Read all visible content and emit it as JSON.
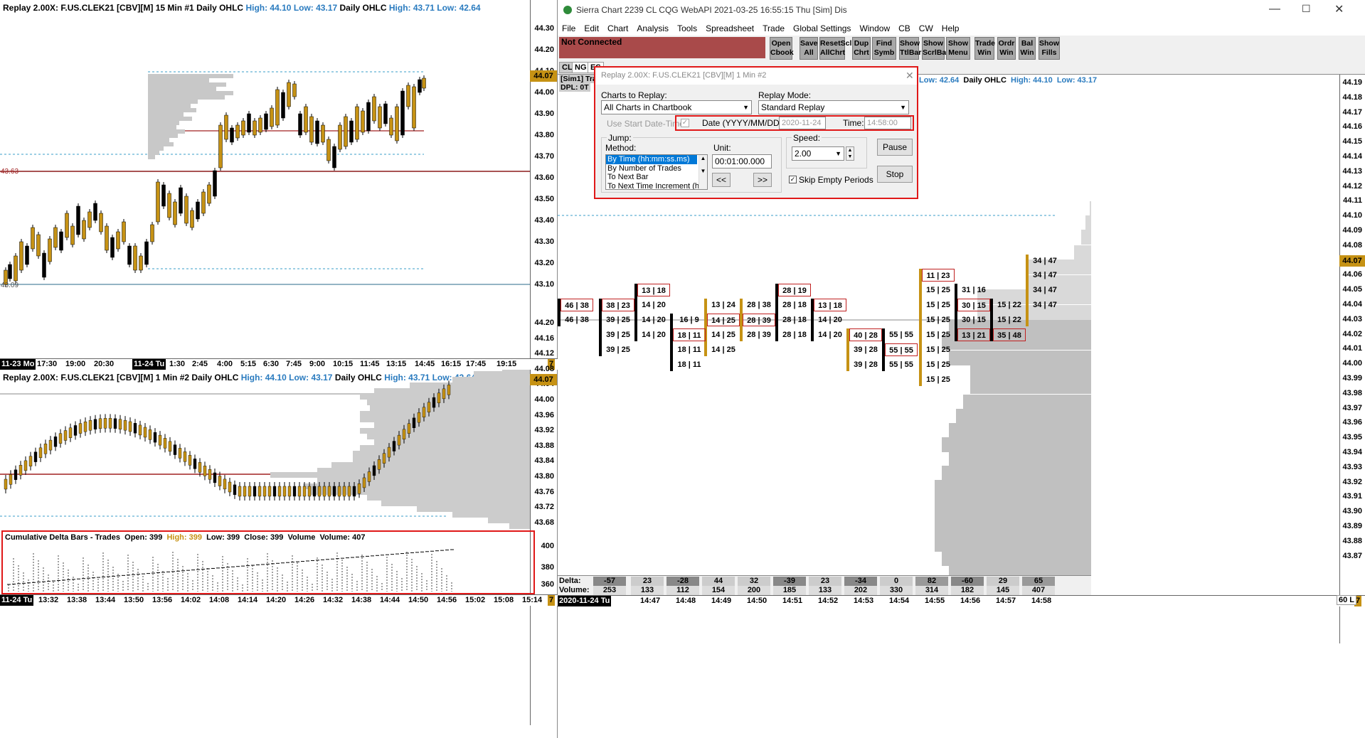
{
  "chart1": {
    "header_prefix": "Replay 2.00X: F.US.CLEK21 [CBV][M]  15 Min  #1 Daily OHLC",
    "high_text": "High: 44.10",
    "low_text": "Low: 43.17",
    "daily_label": "Daily OHLC",
    "daily_high": "High: 43.71",
    "daily_low": "Low: 42.64",
    "yticks": [
      "44.30",
      "44.20",
      "44.10",
      "44.00",
      "43.90",
      "43.80",
      "43.70",
      "43.60",
      "43.50",
      "43.40",
      "43.30",
      "43.20",
      "43.10"
    ],
    "current_price": "44.07",
    "line_label": "43.63",
    "corner_label": "43.09",
    "xticks": [
      "17:30",
      "19:00",
      "20:30",
      "1:30",
      "2:45",
      "4:00",
      "5:15",
      "6:30",
      "7:45",
      "9:00",
      "10:15",
      "11:45",
      "13:15",
      "14:45",
      "16:15",
      "17:45",
      "19:15"
    ],
    "date_start": "11-23 Mo",
    "date_mid": "11-24 Tu",
    "page_num": "7"
  },
  "chart2": {
    "header_prefix": "Replay 2.00X: F.US.CLEK21 [CBV][M]  1 Min  #2 Daily OHLC",
    "high_text": "High: 44.10",
    "low_text": "Low: 43.17",
    "daily_label": "Daily OHLC",
    "daily_high": "High: 43.71",
    "daily_low": "Low: 42.64",
    "yticks": [
      "44.20",
      "44.16",
      "44.12",
      "44.08",
      "44.04",
      "44.00",
      "43.96",
      "43.92",
      "43.88",
      "43.84",
      "43.80",
      "43.76",
      "43.72",
      "43.68"
    ],
    "current_price": "44.07",
    "study_header": "Cumulative Delta Bars - Trades",
    "study_open": "Open: 399",
    "study_high": "High: 399",
    "study_low": "Low: 399",
    "study_close": "Close: 399",
    "study_volume": "Volume",
    "study_volume2": "Volume: 407",
    "study_yticks": [
      "400",
      "380",
      "360"
    ],
    "xticks": [
      "13:32",
      "13:38",
      "13:44",
      "13:50",
      "13:56",
      "14:02",
      "14:08",
      "14:14",
      "14:20",
      "14:26",
      "14:32",
      "14:38",
      "14:44",
      "14:50",
      "14:56",
      "15:02",
      "15:08",
      "15:14"
    ],
    "date_start": "11-24 Tu",
    "page_num": "7"
  },
  "app": {
    "title": "Sierra Chart 2239 CL  CQG WebAPI 2021-03-25  16:55:15 Thu [Sim]  Dis",
    "menu": [
      "File",
      "Edit",
      "Chart",
      "Analysis",
      "Tools",
      "Spreadsheet",
      "Trade",
      "Global Settings",
      "Window",
      "CB",
      "CW",
      "Help"
    ],
    "status": "Not Connected",
    "toolbar": [
      {
        "l1": "Open",
        "l2": "Cbook"
      },
      {
        "l1": "Save",
        "l2": "All"
      },
      {
        "l1": "ResetScl",
        "l2": "AllChrt"
      },
      {
        "l1": "Dup",
        "l2": "Chrt"
      },
      {
        "l1": "Find",
        "l2": "Symb"
      },
      {
        "l1": "Show",
        "l2": "TtlBar"
      },
      {
        "l1": "Show",
        "l2": "ScrlBar"
      },
      {
        "l1": "Show",
        "l2": "Menu"
      },
      {
        "l1": "Trade",
        "l2": "Win"
      },
      {
        "l1": "Ordr",
        "l2": "Win"
      },
      {
        "l1": "Bal",
        "l2": "Win"
      },
      {
        "l1": "Show",
        "l2": "Fills"
      }
    ],
    "tabs": [
      "CL",
      "NG",
      "ES"
    ]
  },
  "chart3": {
    "sim_label": "[Sim1]",
    "sim_label2": "Tra",
    "dpl_label": "DPL: 0T",
    "header_low": "Low: 42.64",
    "header_daily": "Daily OHLC",
    "header_high": "High: 44.10",
    "header_low2": "Low: 43.17",
    "yticks": [
      "44.19",
      "44.18",
      "44.17",
      "44.16",
      "44.15",
      "44.14",
      "44.13",
      "44.12",
      "44.11",
      "44.10",
      "44.09",
      "44.08",
      "44.07",
      "44.06",
      "44.05",
      "44.04",
      "44.03",
      "44.02",
      "44.01",
      "44.00",
      "43.99",
      "43.98",
      "43.97",
      "43.96",
      "43.95",
      "43.94",
      "43.93",
      "43.92",
      "43.91",
      "43.90",
      "43.89",
      "43.88",
      "43.87"
    ],
    "current_price": "44.07",
    "footprint": [
      {
        "t": "46 | 38",
        "box": true
      },
      {
        "t": "46 | 38",
        "box": false
      },
      {
        "t": "38 | 23",
        "box": true
      },
      {
        "t": "39 | 25",
        "box": false
      },
      {
        "t": "39 | 25",
        "box": false
      },
      {
        "t": "39 | 25",
        "box": false
      },
      {
        "t": "13 | 18",
        "box": true
      },
      {
        "t": "14 | 20",
        "box": false
      },
      {
        "t": "14 | 20",
        "box": false
      },
      {
        "t": "14 | 20",
        "box": false
      },
      {
        "t": "16 | 9",
        "box": false
      },
      {
        "t": "18 | 11",
        "box": true
      },
      {
        "t": "18 | 11",
        "box": false
      },
      {
        "t": "18 | 11",
        "box": false
      },
      {
        "t": "13 | 24",
        "box": false
      },
      {
        "t": "14 | 25",
        "box": true
      },
      {
        "t": "14 | 25",
        "box": false
      },
      {
        "t": "14 | 25",
        "box": false
      },
      {
        "t": "28 | 38",
        "box": false
      },
      {
        "t": "28 | 39",
        "box": true
      },
      {
        "t": "28 | 39",
        "box": false
      },
      {
        "t": "28 | 19",
        "box": true
      },
      {
        "t": "28 | 18",
        "box": false
      },
      {
        "t": "28 | 18",
        "box": false
      },
      {
        "t": "28 | 18",
        "box": false
      },
      {
        "t": "13 | 18",
        "box": true
      },
      {
        "t": "14 | 20",
        "box": false
      },
      {
        "t": "14 | 20",
        "box": false
      },
      {
        "t": "40 | 28",
        "box": true
      },
      {
        "t": "39 | 28",
        "box": false
      },
      {
        "t": "39 | 28",
        "box": false
      },
      {
        "t": "55 | 55",
        "box": false
      },
      {
        "t": "55 | 55",
        "box": true
      },
      {
        "t": "55 | 55",
        "box": false
      },
      {
        "t": "11 | 23",
        "box": true
      },
      {
        "t": "15 | 25",
        "box": false
      },
      {
        "t": "15 | 25",
        "box": false
      },
      {
        "t": "15 | 25",
        "box": false
      },
      {
        "t": "15 | 25",
        "box": false
      },
      {
        "t": "15 | 25",
        "box": false
      },
      {
        "t": "15 | 25",
        "box": false
      },
      {
        "t": "15 | 25",
        "box": false
      },
      {
        "t": "31 | 16",
        "box": false
      },
      {
        "t": "30 | 15",
        "box": true
      },
      {
        "t": "30 | 15",
        "box": false
      },
      {
        "t": "13 | 21",
        "box": true
      },
      {
        "t": "15 | 22",
        "box": false
      },
      {
        "t": "15 | 22",
        "box": false
      },
      {
        "t": "35 | 48",
        "box": true
      },
      {
        "t": "34 | 47",
        "box": false
      },
      {
        "t": "34 | 47",
        "box": false
      },
      {
        "t": "34 | 47",
        "box": false
      },
      {
        "t": "34 | 47",
        "box": false
      }
    ],
    "delta_label": "Delta:",
    "volume_label": "Volume:",
    "delta": [
      "-57",
      "23",
      "-28",
      "44",
      "32",
      "-39",
      "23",
      "-34",
      "0",
      "82",
      "-60",
      "29",
      "65"
    ],
    "volume": [
      "253",
      "133",
      "112",
      "154",
      "200",
      "185",
      "133",
      "202",
      "330",
      "314",
      "182",
      "145",
      "407"
    ],
    "xticks": [
      "14:47",
      "14:48",
      "14:49",
      "14:50",
      "14:51",
      "14:52",
      "14:53",
      "14:54",
      "14:55",
      "14:56",
      "14:57",
      "14:58"
    ],
    "date_start": "2020-11-24 Tu",
    "page_num": "7",
    "bottom_right": "60 L"
  },
  "dialog": {
    "title": "Replay 2.00X: F.US.CLEK21 [CBV][M]  1 Min  #2",
    "charts_label": "Charts to Replay:",
    "charts_value": "All Charts in Chartbook",
    "mode_label": "Replay Mode:",
    "mode_value": "Standard Replay",
    "use_start": "Use Start Date-Time",
    "date_label": "Date (YYYY/MM/DD):",
    "date_value": "2020-11-24",
    "time_label": "Time:",
    "time_value": "14:58:00",
    "jump_label": "Jump:",
    "method_label": "Method:",
    "methods": [
      "By Time (hh:mm:ss.ms)",
      "By Number of Trades",
      "To Next Bar",
      "To Next Time Increment (h"
    ],
    "unit_label": "Unit:",
    "unit_value": "00:01:00.000",
    "back_btn": "<<",
    "fwd_btn": ">>",
    "speed_label": "Speed:",
    "speed_value": "2.00",
    "pause_btn": "Pause",
    "stop_btn": "Stop",
    "skip_label": "Skip Empty Periods"
  }
}
